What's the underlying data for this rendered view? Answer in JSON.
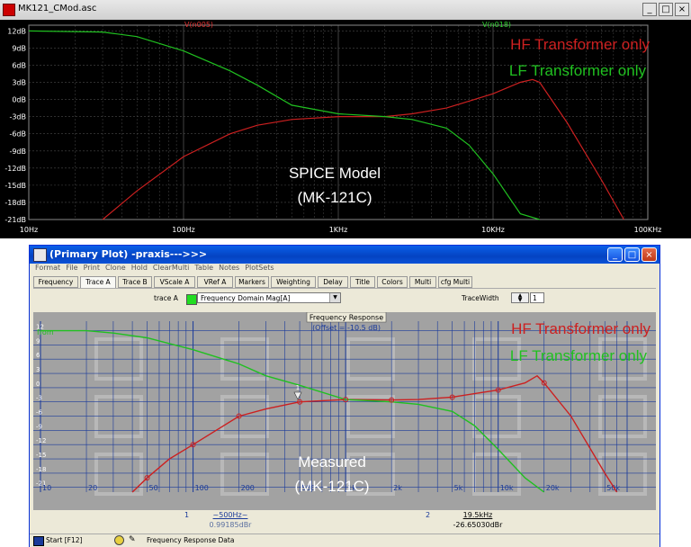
{
  "spice": {
    "window_title": "MK121_CMod.asc",
    "trace_red": "V(n005)",
    "trace_green": "V(n018)",
    "y_ticks": [
      "12dB",
      "9dB",
      "6dB",
      "3dB",
      "0dB",
      "-3dB",
      "-6dB",
      "-9dB",
      "-12dB",
      "-15dB",
      "-18dB",
      "-21dB"
    ],
    "x_ticks": [
      "10Hz",
      "100Hz",
      "1KHz",
      "10KHz",
      "100KHz"
    ],
    "legend_hf": "HF Transformer only",
    "legend_lf": "LF Transformer only",
    "caption_line1": "SPICE Model",
    "caption_line2": "(MK-121C)"
  },
  "praxis": {
    "window_title": "(Primary Plot) -praxis--->>>",
    "menu": [
      "Format",
      "File",
      "Print",
      "Clone",
      "Hold",
      "ClearMulti",
      "Table",
      "Notes",
      "PlotSets"
    ],
    "tabs": [
      "Frequency",
      "Trace A",
      "Trace B",
      "VScale A",
      "VRef A",
      "Markers",
      "Weighting",
      "Delay",
      "Title",
      "Colors",
      "Multi",
      "cfg Multi"
    ],
    "trace_label": "trace A",
    "trace_select": "Frequency Domain Mag[A]",
    "trace_width_label": "TraceWidth",
    "trace_width_value": "1",
    "plot_title": "Frequency Response",
    "offset_label": "(Offset = -10.5 dB)",
    "y_top_label": "from",
    "y_ticks": [
      "12",
      "9",
      "6",
      "3",
      "0",
      "-3",
      "-6",
      "-9",
      "-12",
      "-15",
      "-18",
      "-21"
    ],
    "x_ticks": [
      "10",
      "20",
      "50",
      "100",
      "200",
      "500",
      "1k",
      "2k",
      "5k",
      "10k",
      "20k",
      "50k"
    ],
    "marker_number": "1",
    "legend_hf": "HF Transformer only",
    "legend_lf": "LF Transformer only",
    "caption_line1": "Measured",
    "caption_line2": "(MK-121C)",
    "cursor1": {
      "index": "1",
      "freq": "~500Hz~",
      "value": "0.99185dBr"
    },
    "cursor2": {
      "index": "2",
      "freq": "19.5kHz",
      "value": "-26.65030dBr"
    },
    "start_button": "Start [F12]",
    "status_text": "Frequency Response Data"
  },
  "colors": {
    "hf": "#cc2020",
    "lf": "#20c020",
    "spice_grid": "#4a4a4a",
    "praxis_grid": "#1a3a9a"
  },
  "chart_data": [
    {
      "type": "line",
      "title": "",
      "xlabel": "",
      "ylabel": "",
      "xscale": "log",
      "xlim": [
        10,
        100000
      ],
      "ylim": [
        -21,
        13
      ],
      "series": [
        {
          "name": "V(n005)",
          "color": "#cc2020",
          "x": [
            30,
            50,
            100,
            200,
            300,
            500,
            1000,
            2000,
            3000,
            5000,
            10000,
            15000,
            18000,
            20000,
            30000,
            50000,
            70000
          ],
          "y": [
            -21,
            -16,
            -10,
            -6,
            -4.5,
            -3.5,
            -3,
            -3,
            -2.5,
            -1.5,
            1,
            3,
            3.5,
            3,
            -4,
            -14,
            -21
          ]
        },
        {
          "name": "V(n018)",
          "color": "#20c020",
          "x": [
            10,
            30,
            50,
            100,
            200,
            300,
            500,
            1000,
            2000,
            3000,
            5000,
            7000,
            10000,
            15000,
            20000
          ],
          "y": [
            12,
            11.8,
            11,
            8.5,
            5,
            2.5,
            -1,
            -2.5,
            -3,
            -3.5,
            -5,
            -8,
            -13,
            -20,
            -22
          ]
        }
      ]
    },
    {
      "type": "line",
      "title": "Frequency Response",
      "xlabel": "",
      "ylabel": "",
      "xscale": "log",
      "xlim": [
        10,
        70000
      ],
      "ylim": [
        -22,
        14
      ],
      "series": [
        {
          "name": "",
          "color": "#cc2020",
          "x": [
            40,
            50,
            70,
            100,
            200,
            300,
            500,
            1000,
            2000,
            3000,
            5000,
            10000,
            15000,
            18000,
            20000,
            30000,
            50000,
            60000
          ],
          "y": [
            -22,
            -19,
            -15,
            -12,
            -6,
            -4.5,
            -3,
            -2.5,
            -2.6,
            -2.5,
            -2,
            -0.5,
            1,
            2.5,
            1,
            -6,
            -18,
            -22
          ]
        },
        {
          "name": "",
          "color": "#20c020",
          "x": [
            10,
            20,
            30,
            50,
            100,
            200,
            300,
            500,
            1000,
            2000,
            3000,
            5000,
            7000,
            10000,
            15000,
            20000
          ],
          "y": [
            12,
            12,
            11.5,
            10.5,
            8,
            5,
            2.5,
            0.5,
            -2.5,
            -3,
            -3.5,
            -5,
            -8,
            -13,
            -19,
            -22
          ]
        }
      ]
    }
  ]
}
